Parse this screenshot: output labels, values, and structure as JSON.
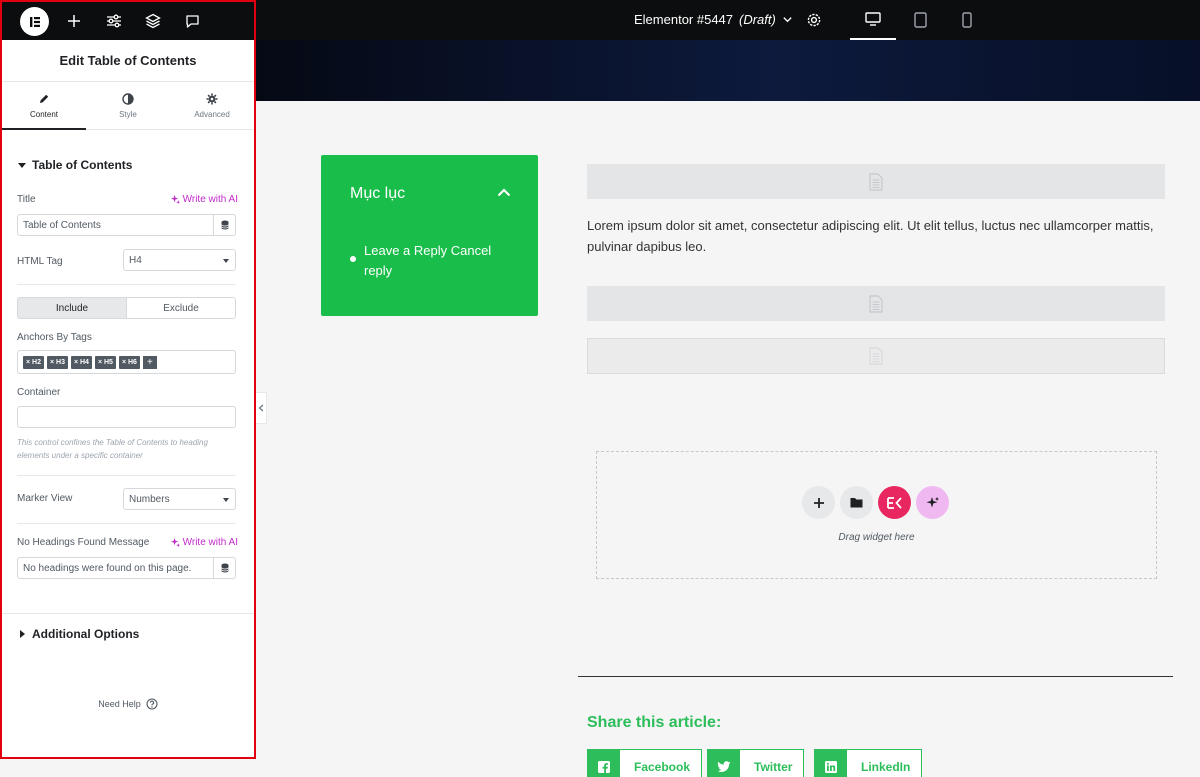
{
  "topbar": {
    "document_name": "Elementor #5447",
    "document_status": "(Draft)"
  },
  "panel": {
    "heading": "Edit Table of Contents",
    "tabs": [
      {
        "label": "Content",
        "icon": "pencil-icon"
      },
      {
        "label": "Style",
        "icon": "half-circle-icon"
      },
      {
        "label": "Advanced",
        "icon": "gear-icon"
      }
    ],
    "section_title": "Table of Contents",
    "title_label": "Title",
    "write_with_ai": "Write with AI",
    "title_value": "Table of Contents",
    "html_tag_label": "HTML Tag",
    "html_tag_value": "H4",
    "include_label": "Include",
    "exclude_label": "Exclude",
    "anchors_label": "Anchors By Tags",
    "anchor_tags": [
      "× H2",
      "× H3",
      "× H4",
      "× H5",
      "× H6"
    ],
    "container_label": "Container",
    "container_value": "",
    "container_help": "This control confines the Table of Contents to heading elements under a specific container",
    "marker_view_label": "Marker View",
    "marker_view_value": "Numbers",
    "no_headings_label": "No Headings Found Message",
    "no_headings_value": "No headings were found on this page.",
    "additional_options": "Additional Options",
    "need_help": "Need Help"
  },
  "canvas": {
    "toc": {
      "title": "Mục lục",
      "items": [
        "Leave a Reply Cancel reply"
      ],
      "color": "#19bd4a"
    },
    "paragraph": "Lorem ipsum dolor sit amet, consectetur adipiscing elit. Ut elit tellus, luctus nec ullamcorper mattis, pulvinar dapibus leo.",
    "drag_label": "Drag widget here",
    "share_title": "Share this article:",
    "share_buttons": [
      {
        "label": "Facebook",
        "icon": "facebook-icon"
      },
      {
        "label": "Twitter",
        "icon": "twitter-icon"
      },
      {
        "label": "LinkedIn",
        "icon": "linkedin-icon"
      }
    ],
    "share_color": "#2dbd5a"
  }
}
